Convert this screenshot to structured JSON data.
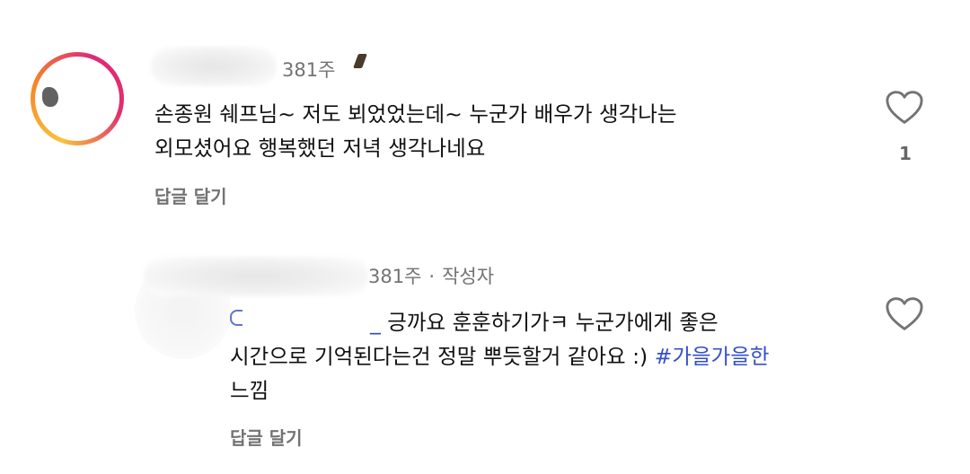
{
  "comments": [
    {
      "age": "381주",
      "text_line1": "손종원 쉐프님~ 저도 뵈었었는데~ 누군가 배우가 생각나는",
      "text_line2": "외모셨어요 행복했던 저녁 생각나네요",
      "reply_label": "답글 달기",
      "like_count": "1",
      "like_icon": "heart-outline-icon"
    },
    {
      "age": "381주",
      "separator": "·",
      "author_badge": "작성자",
      "mention_visible": "_",
      "text_line1_rest": "긍까요 훈훈하기가ㅋ 누군가에게 좋은",
      "text_line2_plain": "시간으로 기억된다는건 정말 뿌듯할거 같아요 :) ",
      "hashtag": "#가을가을한",
      "text_line3": "느낌",
      "reply_label": "답글 달기",
      "like_icon": "heart-outline-icon"
    }
  ],
  "colors": {
    "meta_text": "#737373",
    "mention": "#2b4fb6",
    "hashtag": "#3550c8",
    "story_ring": [
      "#f9c23c",
      "#f58529",
      "#dd2a7b"
    ]
  }
}
